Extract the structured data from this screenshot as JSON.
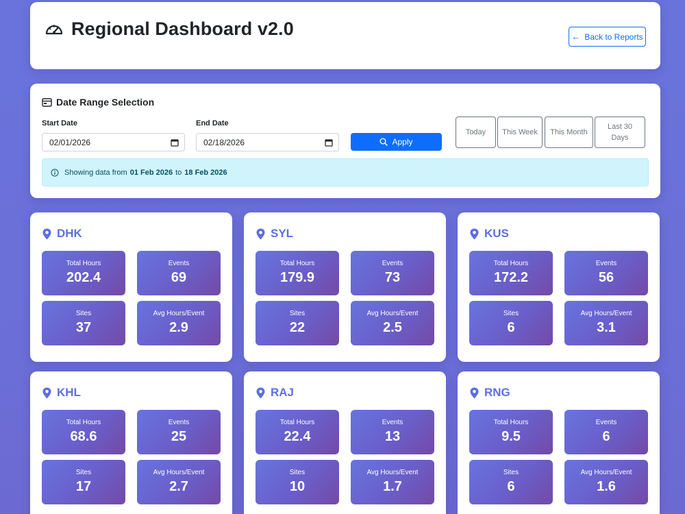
{
  "header": {
    "title": "Regional Dashboard v2.0",
    "back_label": "Back to Reports"
  },
  "date_range": {
    "title": "Date Range Selection",
    "start_label": "Start Date",
    "start_value": "02/01/2026",
    "end_label": "End Date",
    "end_value": "02/18/2026",
    "apply_label": "Apply",
    "quick": [
      "Today",
      "This Week",
      "This Month",
      "Last 30 Days"
    ],
    "alert_prefix": "Showing data from",
    "alert_from": "01 Feb 2026",
    "alert_mid": "to",
    "alert_to": "18 Feb 2026"
  },
  "stat_labels": {
    "total_hours": "Total Hours",
    "events": "Events",
    "sites": "Sites",
    "avg": "Avg Hours/Event"
  },
  "regions": [
    {
      "name": "DHK",
      "total_hours": "202.4",
      "events": "69",
      "sites": "37",
      "avg": "2.9"
    },
    {
      "name": "SYL",
      "total_hours": "179.9",
      "events": "73",
      "sites": "22",
      "avg": "2.5"
    },
    {
      "name": "KUS",
      "total_hours": "172.2",
      "events": "56",
      "sites": "6",
      "avg": "3.1"
    },
    {
      "name": "KHL",
      "total_hours": "68.6",
      "events": "25",
      "sites": "17",
      "avg": "2.7"
    },
    {
      "name": "RAJ",
      "total_hours": "22.4",
      "events": "13",
      "sites": "10",
      "avg": "1.7"
    },
    {
      "name": "RNG",
      "total_hours": "9.5",
      "events": "6",
      "sites": "6",
      "avg": "1.6"
    }
  ],
  "colors": {
    "background": "#6a73dc",
    "primary": "#0d6efd",
    "region_title": "#5b6fe0",
    "alert_bg": "#cff4fc"
  }
}
